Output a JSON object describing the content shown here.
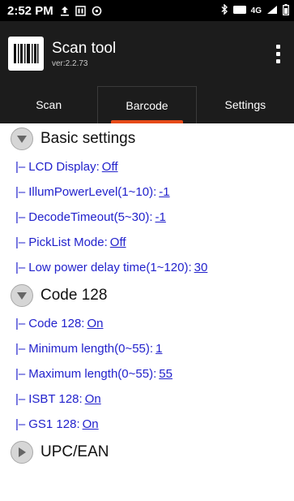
{
  "status_bar": {
    "time": "2:52 PM",
    "network_label": "4G"
  },
  "app": {
    "title": "Scan tool",
    "version": "ver:2.2.73"
  },
  "tabs": [
    {
      "label": "Scan",
      "active": false
    },
    {
      "label": "Barcode",
      "active": true
    },
    {
      "label": "Settings",
      "active": false
    }
  ],
  "sections": {
    "basic": {
      "title": "Basic settings",
      "expanded": true,
      "items": [
        {
          "prefix": "|–",
          "label": "LCD Display:",
          "value": "Off"
        },
        {
          "prefix": "|–",
          "label": "IllumPowerLevel(1~10):",
          "value": "-1"
        },
        {
          "prefix": "|–",
          "label": "DecodeTimeout(5~30):",
          "value": "-1"
        },
        {
          "prefix": "|–",
          "label": "PickList Mode:",
          "value": "Off"
        },
        {
          "prefix": "|–",
          "label": "Low power delay time(1~120):",
          "value": "30"
        }
      ]
    },
    "code128": {
      "title": "Code 128",
      "expanded": true,
      "items": [
        {
          "prefix": "|–",
          "label": "Code 128:",
          "value": "On"
        },
        {
          "prefix": "|–",
          "label": "Minimum length(0~55):",
          "value": "1"
        },
        {
          "prefix": "|–",
          "label": "Maximum length(0~55):",
          "value": "55"
        },
        {
          "prefix": "|–",
          "label": "ISBT 128:",
          "value": "On"
        },
        {
          "prefix": "|–",
          "label": "GS1 128:",
          "value": "On"
        }
      ]
    },
    "upc": {
      "title": "UPC/EAN",
      "expanded": false
    }
  },
  "colors": {
    "accent": "#e64a19",
    "link": "#2222cc",
    "appbar": "#1c1c1c"
  }
}
